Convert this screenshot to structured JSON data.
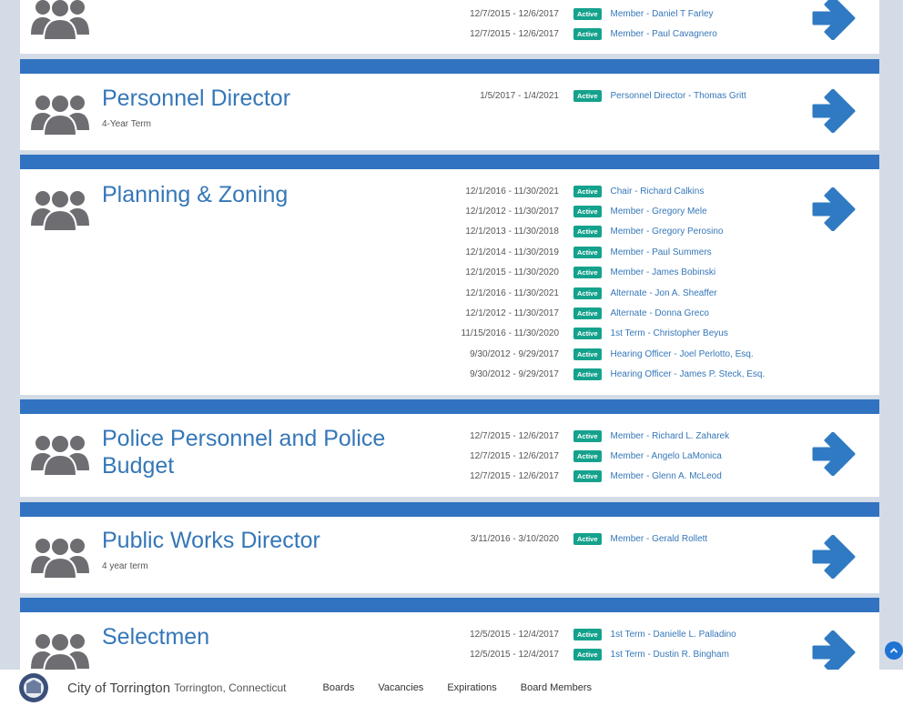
{
  "boards": [
    {
      "title": "",
      "subtitle": "",
      "members": [
        {
          "dates": "12/7/2015 - 12/6/2017",
          "status": "Active",
          "name": "Member - Daniel T Farley"
        },
        {
          "dates": "12/7/2015 - 12/6/2017",
          "status": "Active",
          "name": "Member - Paul Cavagnero"
        }
      ]
    },
    {
      "title": "Personnel Director",
      "subtitle": "4-Year Term",
      "members": [
        {
          "dates": "1/5/2017 - 1/4/2021",
          "status": "Active",
          "name": "Personnel Director - Thomas Gritt"
        }
      ]
    },
    {
      "title": "Planning & Zoning",
      "subtitle": "",
      "members": [
        {
          "dates": "12/1/2016 - 11/30/2021",
          "status": "Active",
          "name": "Chair - Richard Calkins"
        },
        {
          "dates": "12/1/2012 - 11/30/2017",
          "status": "Active",
          "name": "Member - Gregory Mele"
        },
        {
          "dates": "12/1/2013 - 11/30/2018",
          "status": "Active",
          "name": "Member - Gregory Perosino"
        },
        {
          "dates": "12/1/2014 - 11/30/2019",
          "status": "Active",
          "name": "Member - Paul Summers"
        },
        {
          "dates": "12/1/2015 - 11/30/2020",
          "status": "Active",
          "name": "Member - James Bobinski"
        },
        {
          "dates": "12/1/2016 - 11/30/2021",
          "status": "Active",
          "name": "Alternate - Jon A. Sheaffer"
        },
        {
          "dates": "12/1/2012 - 11/30/2017",
          "status": "Active",
          "name": "Alternate - Donna Greco"
        },
        {
          "dates": "11/15/2016 - 11/30/2020",
          "status": "Active",
          "name": "1st Term - Christopher Beyus"
        },
        {
          "dates": "9/30/2012 - 9/29/2017",
          "status": "Active",
          "name": "Hearing Officer - Joel Perlotto, Esq."
        },
        {
          "dates": "9/30/2012 - 9/29/2017",
          "status": "Active",
          "name": "Hearing Officer - James P. Steck, Esq."
        }
      ]
    },
    {
      "title": "Police Personnel and Police Budget",
      "subtitle": "",
      "members": [
        {
          "dates": "12/7/2015 - 12/6/2017",
          "status": "Active",
          "name": "Member - Richard L. Zaharek"
        },
        {
          "dates": "12/7/2015 - 12/6/2017",
          "status": "Active",
          "name": "Member - Angelo LaMonica"
        },
        {
          "dates": "12/7/2015 - 12/6/2017",
          "status": "Active",
          "name": "Member - Glenn A. McLeod"
        }
      ]
    },
    {
      "title": "Public Works Director",
      "subtitle": "4 year term",
      "members": [
        {
          "dates": "3/11/2016 - 3/10/2020",
          "status": "Active",
          "name": "Member - Gerald Rollett"
        }
      ]
    },
    {
      "title": "Selectmen",
      "subtitle": "",
      "members": [
        {
          "dates": "12/5/2015 - 12/4/2017",
          "status": "Active",
          "name": "1st Term - Danielle L. Palladino"
        },
        {
          "dates": "12/5/2015 - 12/4/2017",
          "status": "Active",
          "name": "1st Term - Dustin R. Bingham"
        }
      ]
    }
  ],
  "footer": {
    "city": "City of Torrington",
    "location": "Torrington, Connecticut",
    "nav": [
      "Boards",
      "Vacancies",
      "Expirations",
      "Board Members"
    ]
  },
  "colors": {
    "accent": "#3173c0",
    "title": "#3577b8",
    "badge": "#15a28d",
    "icon": "#6d6d72",
    "background": "#d3dbe6"
  },
  "icons": {
    "board": "people-group-icon",
    "open": "arrow-right-icon",
    "scroll": "chevron-up-icon"
  }
}
